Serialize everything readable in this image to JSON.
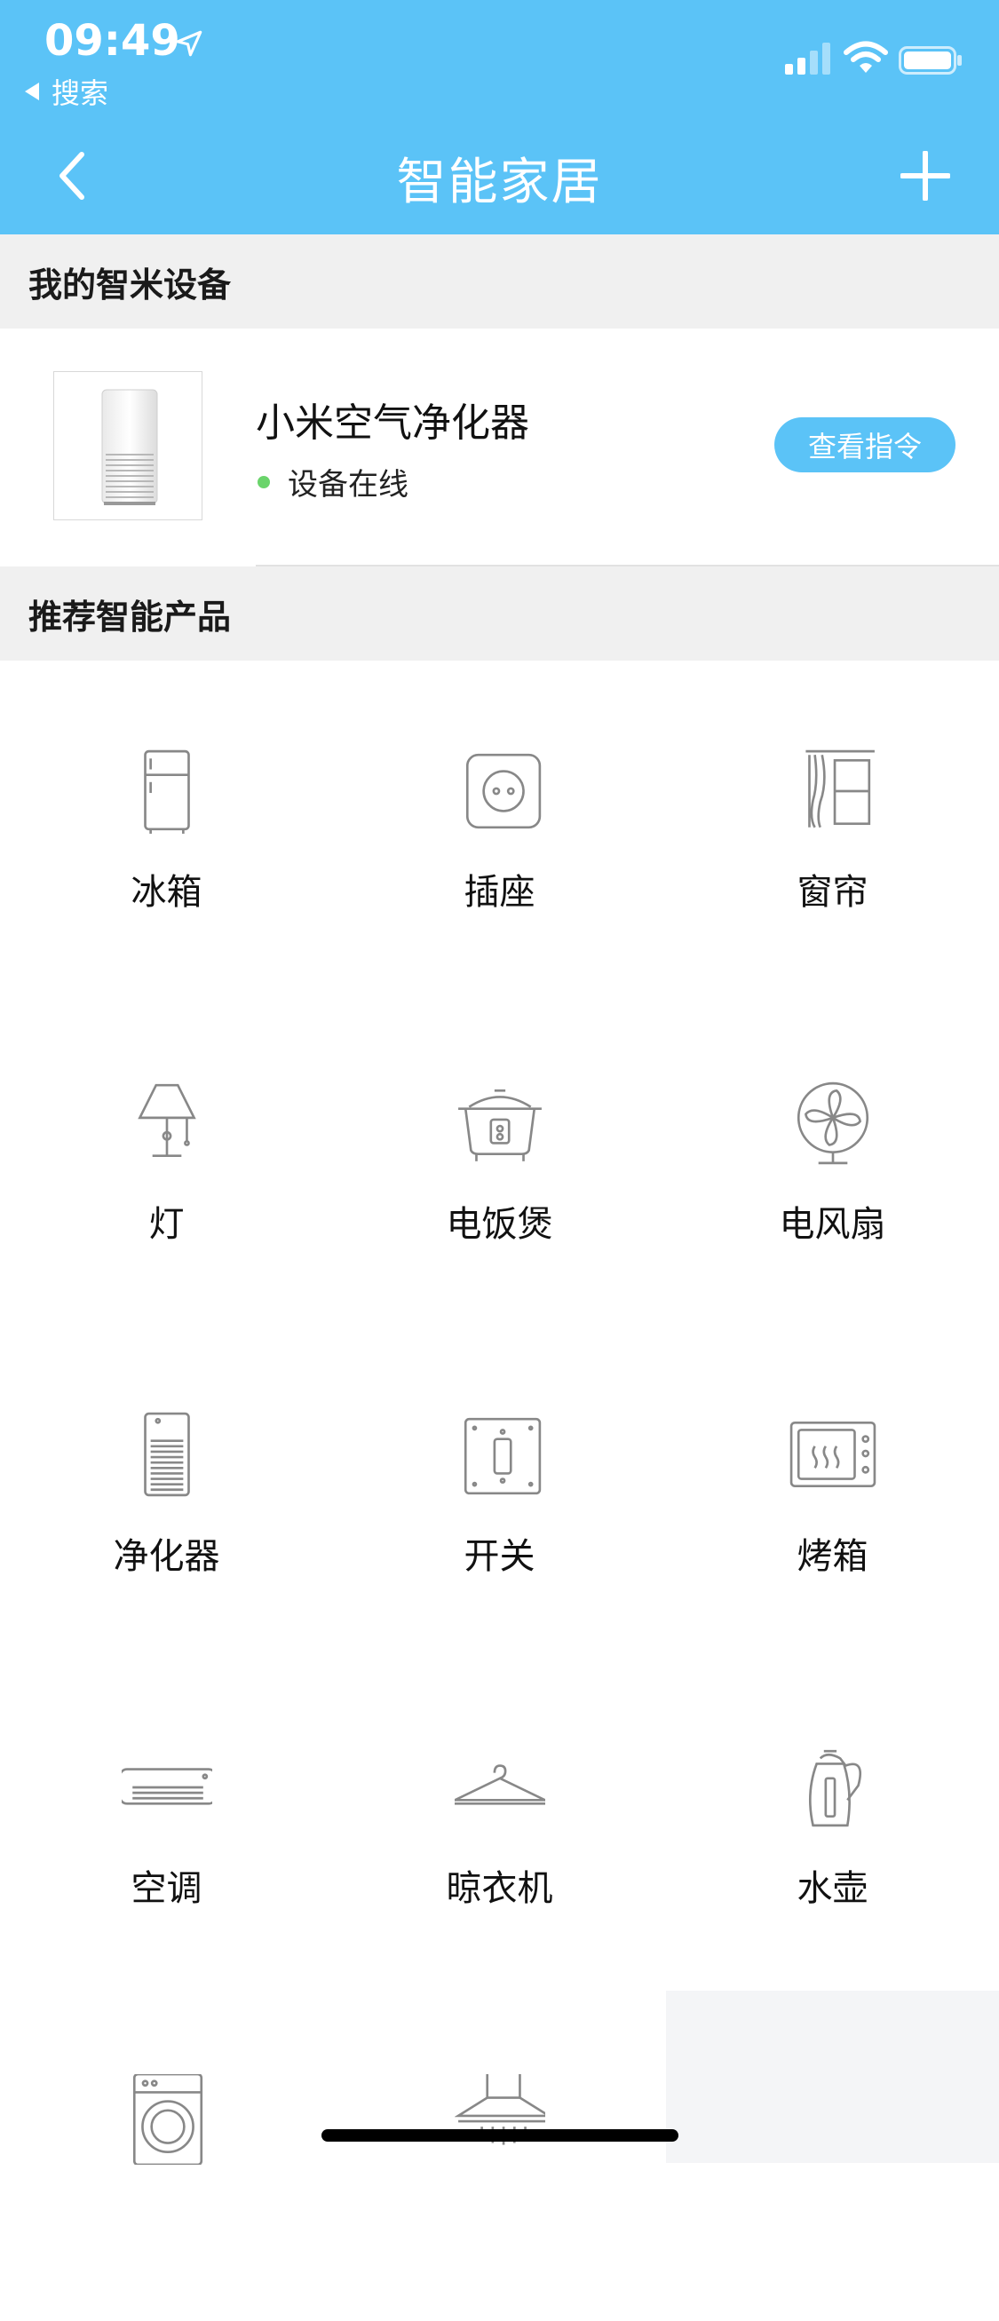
{
  "status_bar": {
    "time": "09:49",
    "back_app_label": "搜索"
  },
  "nav": {
    "title": "智能家居"
  },
  "sections": {
    "my_devices": "我的智米设备",
    "recommended": "推荐智能产品"
  },
  "device": {
    "name": "小米空气净化器",
    "status": "设备在线",
    "button_label": "查看指令",
    "status_color": "#6ad46b"
  },
  "products": [
    {
      "label": "冰箱",
      "icon": "fridge-icon"
    },
    {
      "label": "插座",
      "icon": "socket-icon"
    },
    {
      "label": "窗帘",
      "icon": "curtain-icon"
    },
    {
      "label": "灯",
      "icon": "lamp-icon"
    },
    {
      "label": "电饭煲",
      "icon": "rice-cooker-icon"
    },
    {
      "label": "电风扇",
      "icon": "fan-icon"
    },
    {
      "label": "净化器",
      "icon": "purifier-icon"
    },
    {
      "label": "开关",
      "icon": "switch-icon"
    },
    {
      "label": "烤箱",
      "icon": "oven-icon"
    },
    {
      "label": "空调",
      "icon": "air-conditioner-icon"
    },
    {
      "label": "晾衣机",
      "icon": "hanger-icon"
    },
    {
      "label": "水壶",
      "icon": "kettle-icon"
    },
    {
      "label": "",
      "icon": "washing-machine-icon"
    },
    {
      "label": "",
      "icon": "range-hood-icon"
    }
  ],
  "colors": {
    "accent": "#5bc3f7",
    "section_bg": "#f0f0f0",
    "icon_stroke": "#888888"
  }
}
